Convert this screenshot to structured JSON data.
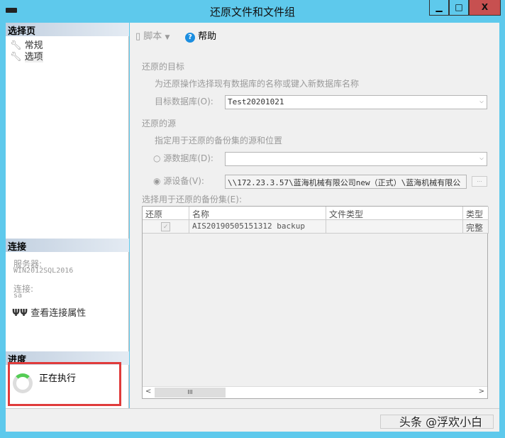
{
  "window": {
    "title": "还原文件和文件组",
    "minimize": "▁",
    "maximize": "□",
    "close": "X"
  },
  "sidebar": {
    "select_page": "选择页",
    "pages": [
      {
        "label": "常规"
      },
      {
        "label": "选项"
      }
    ],
    "connection": {
      "header": "连接",
      "server_label": "服务器:",
      "server": "WIN2012SQL2016",
      "conn_label": "连接:",
      "conn": "sa",
      "view_props": "查看连接属性"
    },
    "progress": {
      "header": "进度",
      "status": "正在执行"
    }
  },
  "toolbar": {
    "script": "脚本",
    "help": "帮助"
  },
  "destination": {
    "header": "还原的目标",
    "hint": "为还原操作选择现有数据库的名称或键入新数据库名称",
    "target_label": "目标数据库(O):",
    "target_value": "Test20201021"
  },
  "source": {
    "header": "还原的源",
    "hint": "指定用于还原的备份集的源和位置",
    "db_label": "源数据库(D):",
    "db_value": "",
    "device_label": "源设备(V):",
    "device_value": "\\\\172.23.3.57\\蓝海机械有限公司new（正式）\\蓝海机械有限公",
    "browse": "..."
  },
  "backup_sets": {
    "label": "选择用于还原的备份集(E):",
    "columns": [
      "还原",
      "名称",
      "文件类型",
      "类型"
    ],
    "rows": [
      {
        "restore": true,
        "name": "AIS20190505151312 backup",
        "file_type": "",
        "type": "完整"
      }
    ],
    "scroll_thumb": "III"
  },
  "watermark": "头条 @浮欢小白"
}
